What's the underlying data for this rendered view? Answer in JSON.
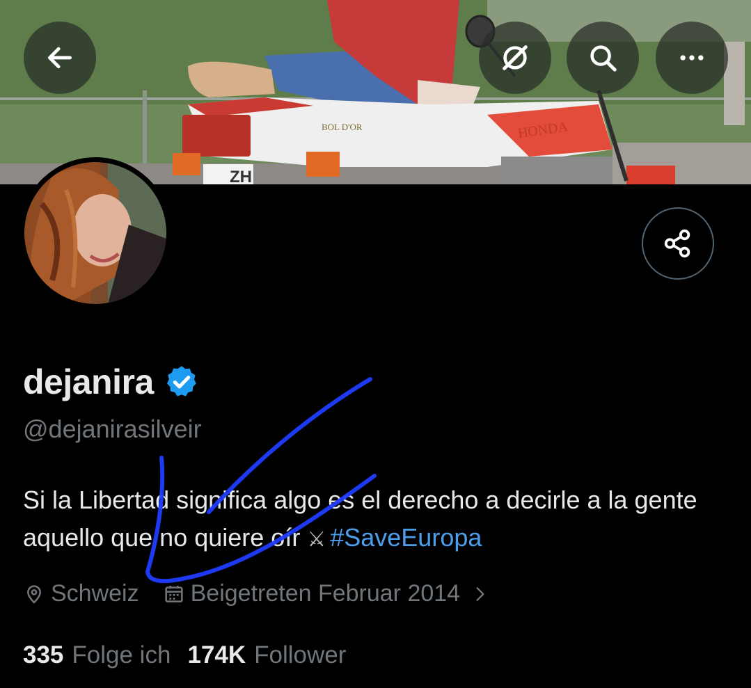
{
  "header": {
    "back_icon": "arrow-left-icon",
    "grok_icon": "grok-icon",
    "search_icon": "search-icon",
    "more_icon": "more-horizontal-icon"
  },
  "banner": {
    "bike_brand": "HONDA",
    "bike_model": "BOL D'OR",
    "plate": "ZH"
  },
  "profile": {
    "display_name": "dejanira",
    "verified": true,
    "handle": "@dejanirasilveir",
    "bio_text": "Si la Libertad significa algo es el derecho a decirle a la gente aquello que no quiere oír",
    "bio_emoji": "⚔",
    "bio_hashtag": "#SaveEuropa",
    "location": "Schweiz",
    "joined": "Beigetreten Februar 2014",
    "following_count": "335",
    "following_label": "Folge ich",
    "followers_count": "174K",
    "followers_label": "Follower"
  },
  "colors": {
    "background": "#000000",
    "primary_text": "#e7e9ea",
    "secondary_text": "#71767b",
    "link": "#4d9fec",
    "verified_badge": "#1d9bf0",
    "scribble": "#1f3dff"
  }
}
